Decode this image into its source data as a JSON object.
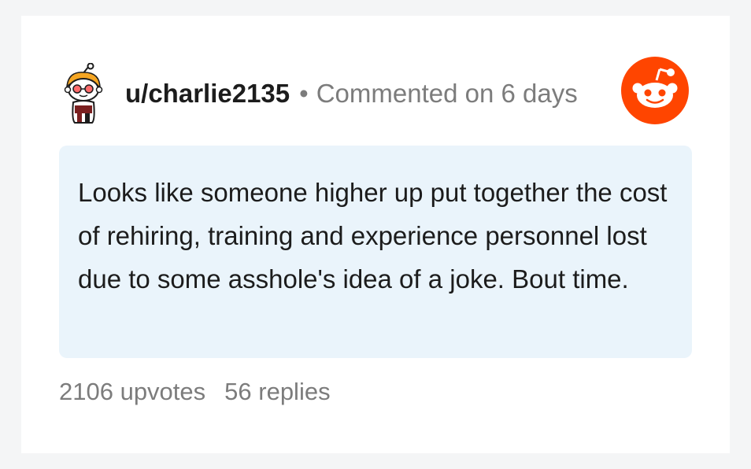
{
  "comment": {
    "username": "u/charlie2135",
    "separator": "•",
    "meta": "Commented on 6 days",
    "body": "Looks like someone higher up put together the cost of rehiring, training and experience personnel lost due to some asshole's idea of a joke. Bout time.",
    "upvotes": "2106 upvotes",
    "replies": "56 replies"
  },
  "colors": {
    "accent": "#ff4500",
    "comment_bg": "#eaf4fb",
    "muted_text": "#7c7c7c"
  },
  "icons": {
    "avatar": "snoo-avatar-icon",
    "logo": "reddit-logo-icon"
  }
}
